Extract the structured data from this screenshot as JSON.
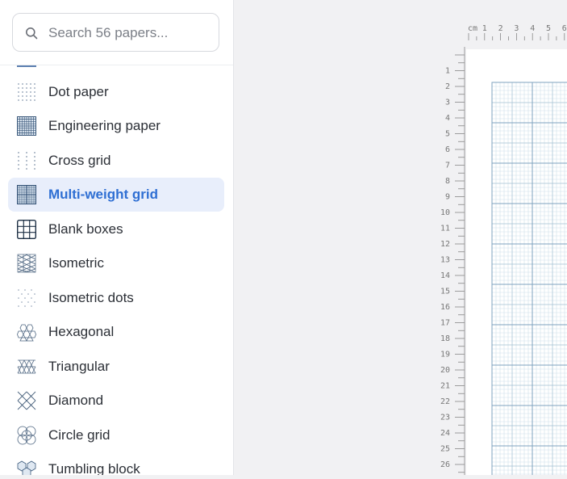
{
  "search": {
    "placeholder": "Search 56 papers..."
  },
  "papers": [
    {
      "label": "Dot paper",
      "icon": "dot-paper-icon"
    },
    {
      "label": "Engineering paper",
      "icon": "engineering-paper-icon"
    },
    {
      "label": "Cross grid",
      "icon": "cross-grid-icon"
    },
    {
      "label": "Multi-weight grid",
      "icon": "multi-weight-grid-icon",
      "active": true
    },
    {
      "label": "Blank boxes",
      "icon": "blank-boxes-icon"
    },
    {
      "label": "Isometric",
      "icon": "isometric-icon"
    },
    {
      "label": "Isometric dots",
      "icon": "isometric-dots-icon"
    },
    {
      "label": "Hexagonal",
      "icon": "hexagonal-icon"
    },
    {
      "label": "Triangular",
      "icon": "triangular-icon"
    },
    {
      "label": "Diamond",
      "icon": "diamond-icon"
    },
    {
      "label": "Circle grid",
      "icon": "circle-grid-icon"
    },
    {
      "label": "Tumbling block",
      "icon": "tumbling-block-icon"
    }
  ],
  "ruler": {
    "unit": "cm",
    "top_labels": [
      "1",
      "2",
      "3",
      "4",
      "5",
      "6"
    ],
    "left_labels": [
      "1",
      "2",
      "3",
      "4",
      "5",
      "6",
      "7",
      "8",
      "9",
      "10",
      "11",
      "12",
      "13",
      "14",
      "15",
      "16",
      "17",
      "18",
      "19",
      "20",
      "21",
      "22",
      "23",
      "24",
      "25",
      "26"
    ]
  },
  "colors": {
    "accent": "#2f6fd3",
    "active_bg": "#e8eefb",
    "grid_major": "#7fa3bf",
    "grid_minor": "#cfe0ea"
  }
}
